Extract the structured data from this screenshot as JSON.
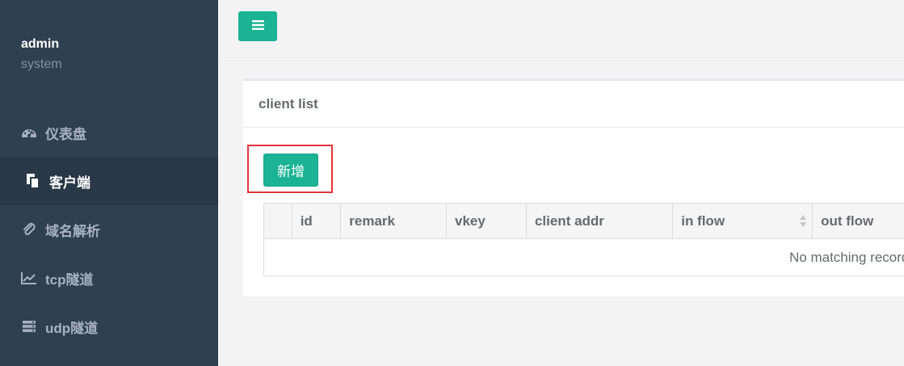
{
  "sidebar": {
    "profile": {
      "name": "admin",
      "role": "system"
    },
    "items": [
      {
        "label": "仪表盘",
        "icon": "dashboard-icon"
      },
      {
        "label": "客户端",
        "icon": "copy-icon"
      },
      {
        "label": "域名解析",
        "icon": "paperclip-icon"
      },
      {
        "label": "tcp隧道",
        "icon": "line-chart-icon"
      },
      {
        "label": "udp隧道",
        "icon": "server-icon"
      }
    ],
    "active_index": 1
  },
  "topbar": {
    "menu_button_icon": "bars-icon"
  },
  "panel": {
    "title": "client list",
    "add_button_label": "新增",
    "table": {
      "columns": [
        "",
        "id",
        "remark",
        "vkey",
        "client addr",
        "in flow",
        "out flow"
      ],
      "empty_message": "No matching records found"
    }
  },
  "colors": {
    "sidebar_bg": "#2f4050",
    "sidebar_active_bg": "#293846",
    "accent": "#1ab394",
    "highlight_border": "#e5343a"
  }
}
